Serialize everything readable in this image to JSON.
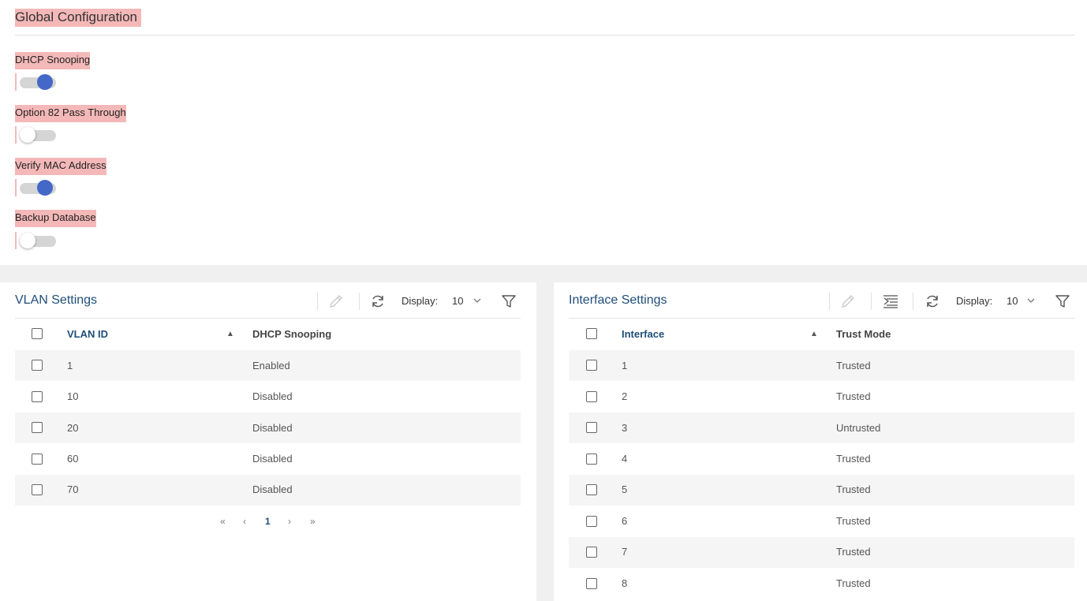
{
  "global": {
    "title": "Global Configuration",
    "settings": [
      {
        "label": "DHCP Snooping",
        "enabled": true
      },
      {
        "label": "Option 82 Pass Through",
        "enabled": false
      },
      {
        "label": "Verify MAC Address",
        "enabled": true
      },
      {
        "label": "Backup Database",
        "enabled": false
      }
    ]
  },
  "colors": {
    "accent": "#4468c8",
    "title_blue": "#1f4e79",
    "highlight": "#f4b8b8"
  },
  "vlan": {
    "title": "VLAN Settings",
    "display_label": "Display:",
    "display_value": "10",
    "columns": [
      "VLAN ID",
      "DHCP Snooping"
    ],
    "rows": [
      {
        "id": "1",
        "status": "Enabled"
      },
      {
        "id": "10",
        "status": "Disabled"
      },
      {
        "id": "20",
        "status": "Disabled"
      },
      {
        "id": "60",
        "status": "Disabled"
      },
      {
        "id": "70",
        "status": "Disabled"
      }
    ],
    "pagination": {
      "first": "«",
      "prev": "‹",
      "current": "1",
      "next": "›",
      "last": "»"
    }
  },
  "interface": {
    "title": "Interface Settings",
    "display_label": "Display:",
    "display_value": "10",
    "columns": [
      "Interface",
      "Trust Mode"
    ],
    "rows": [
      {
        "id": "1",
        "mode": "Trusted"
      },
      {
        "id": "2",
        "mode": "Trusted"
      },
      {
        "id": "3",
        "mode": "Untrusted"
      },
      {
        "id": "4",
        "mode": "Trusted"
      },
      {
        "id": "5",
        "mode": "Trusted"
      },
      {
        "id": "6",
        "mode": "Trusted"
      },
      {
        "id": "7",
        "mode": "Trusted"
      },
      {
        "id": "8",
        "mode": "Trusted"
      }
    ]
  },
  "icons": {
    "edit": "pencil-icon",
    "refresh": "refresh-icon",
    "filter": "filter-icon",
    "chevron": "chevron-down-icon",
    "columns": "column-settings-icon",
    "sort": "sort-ascending-icon"
  }
}
